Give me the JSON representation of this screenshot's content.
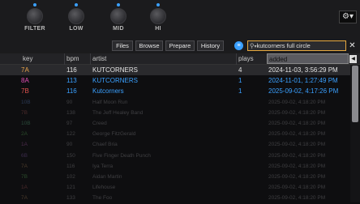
{
  "knobs": [
    {
      "label": "FILTER"
    },
    {
      "label": "LOW"
    },
    {
      "label": "MID"
    },
    {
      "label": "HI"
    }
  ],
  "toolbar": {
    "buttons": [
      "Files",
      "Browse",
      "Prepare",
      "History"
    ],
    "search_value": "kutcorners full circle",
    "clear_symbol": "✕",
    "gear_symbol": "⚙▾"
  },
  "columns": {
    "key": "key",
    "bpm": "bpm",
    "artist": "artist",
    "plays": "plays",
    "added": "added"
  },
  "colors": {
    "accent": "#3aa0ff",
    "search_border": "#e7a93f",
    "key_7A": "#e8a34a",
    "key_8A": "#e04fb5",
    "key_7B": "#e0524f"
  },
  "rows": [
    {
      "key": "7A",
      "bpm": "116",
      "artist": "KUTCORNERS",
      "plays": "4",
      "added": "2024-11-03, 3:56:29 PM",
      "color": "#e8a34a",
      "text_color": "#e4e4e4"
    },
    {
      "key": "8A",
      "bpm": "113",
      "artist": "KUTCORNERS",
      "plays": "1",
      "added": "2024-11-01, 1:27:49 PM",
      "color": "#e04fb5",
      "text_color": "#3aa0ff"
    },
    {
      "key": "7B",
      "bpm": "116",
      "artist": "Kutcorners",
      "plays": "1",
      "added": "2025-09-02, 4:17:26 PM",
      "color": "#e0524f",
      "text_color": "#3aa0ff"
    },
    {
      "key": "10B",
      "bpm": "90",
      "artist": "Half Moon Run",
      "plays": "",
      "added": "2025-09-02, 4:18:20 PM",
      "color": "#2b3a55",
      "text_color": "#3f3f42"
    },
    {
      "key": "7B",
      "bpm": "138",
      "artist": "The Jeff Healey Band",
      "plays": "",
      "added": "2025-09-02, 4:18:20 PM",
      "color": "#4a2a2a",
      "text_color": "#3f3f42"
    },
    {
      "key": "10B",
      "bpm": "97",
      "artist": "Creed",
      "plays": "",
      "added": "2025-09-02, 4:18:20 PM",
      "color": "#2a4a3a",
      "text_color": "#3f3f42"
    },
    {
      "key": "2A",
      "bpm": "122",
      "artist": "George FitzGerald",
      "plays": "",
      "added": "2025-09-02, 4:18:20 PM",
      "color": "#2a4a2a",
      "text_color": "#3f3f42"
    },
    {
      "key": "1A",
      "bpm": "90",
      "artist": "Chaef Bria",
      "plays": "",
      "added": "2025-09-02, 4:18:20 PM",
      "color": "#4a2a4a",
      "text_color": "#3f3f42"
    },
    {
      "key": "6B",
      "bpm": "150",
      "artist": "Five Finger Death Punch",
      "plays": "",
      "added": "2025-09-02, 4:18:20 PM",
      "color": "#3a2a4a",
      "text_color": "#3f3f42"
    },
    {
      "key": "7A",
      "bpm": "116",
      "artist": "Iya Terra",
      "plays": "",
      "added": "2025-09-02, 4:18:20 PM",
      "color": "#4a3a2a",
      "text_color": "#3f3f42"
    },
    {
      "key": "7B",
      "bpm": "102",
      "artist": "Aidan Martin",
      "plays": "",
      "added": "2025-09-02, 4:18:20 PM",
      "color": "#2a4a2a",
      "text_color": "#3f3f42"
    },
    {
      "key": "1A",
      "bpm": "121",
      "artist": "Lifehouse",
      "plays": "",
      "added": "2025-09-02, 4:18:20 PM",
      "color": "#4a2a2a",
      "text_color": "#3f3f42"
    },
    {
      "key": "7A",
      "bpm": "133",
      "artist": "The Foo",
      "plays": "",
      "added": "2025-09-02, 4:18:20 PM",
      "color": "#4a3a2a",
      "text_color": "#3f3f42"
    }
  ]
}
